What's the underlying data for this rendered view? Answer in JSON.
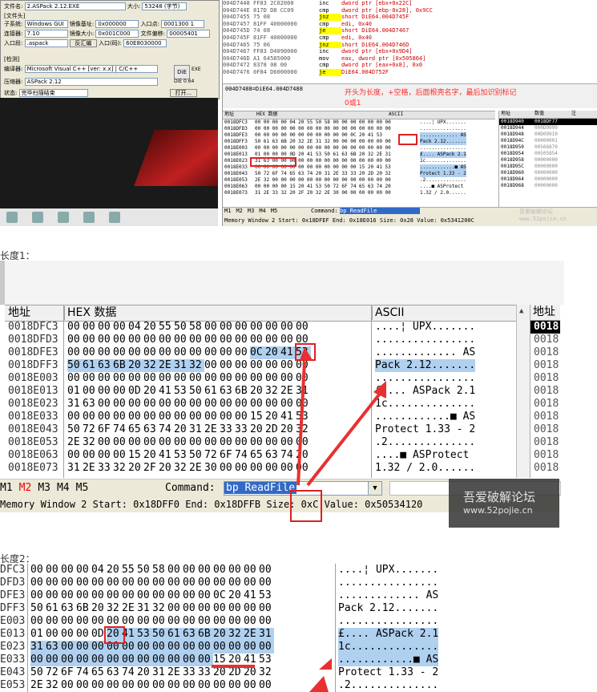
{
  "top": {
    "pe_dialog": {
      "file_label": "文件名:",
      "file_value": "2.ASPack 2.12.EXE",
      "size_label": "大小:",
      "size_value": "53248 (字节)",
      "section_title": "[文件头]",
      "subsystem_label": "子系统:",
      "subsystem_value": "Windows GUI",
      "imagebase_label": "镜像基址:",
      "imagebase_value": "0x000000",
      "entry_label": "入口点:",
      "entry_value": "0001300 1",
      "linker_label": "连接器:",
      "linker_value": "7.10",
      "imagesize_label": "镜像大小:",
      "imagesize_value": "0x001C000",
      "fileoffset_label": "文件偏移:",
      "fileoffset_value": "00005401",
      "ep_section_label": "入口段:",
      "ep_section_value": ".aspack",
      "disasm_button": "反汇编",
      "entry2_label": "入口(码):",
      "entry2_value": "60E8030000",
      "detect_title": "[检测]",
      "compiler_label": "编译器:",
      "compiler_value": "Microsoft Visual C++ [ver: x.x] | C/C++",
      "packer_label": "压缩器:",
      "packer_value": "ASPack 2.12",
      "status_label": "状态:",
      "status_value": "完毕扫描结束",
      "open_button": "打开...",
      "die_label": "DiE",
      "die_version": "DiE 0.64",
      "exe_label": "EXE"
    },
    "asm_lines": [
      {
        "addr": "004D7448",
        "bytes": "FF83 2C02000",
        "mnem": "inc",
        "op": "dword ptr [ebx+0x22C]",
        "jump": false
      },
      {
        "addr": "004D744E",
        "bytes": "817D D8 CC09",
        "mnem": "cmp",
        "op": "dword ptr [ebp-0x28], 0x9CC",
        "jump": false
      },
      {
        "addr": "004D7455",
        "bytes": "75 08",
        "mnem": "jnz",
        "op": "short DiE64.004D745F",
        "jump": true
      },
      {
        "addr": "004D7457",
        "bytes": "81FF 40000000",
        "mnem": "cmp",
        "op": "edi, 0x40",
        "jump": false
      },
      {
        "addr": "004D745D",
        "bytes": "74 08",
        "mnem": "je",
        "op": "short DiE64.004D7467",
        "jump": true
      },
      {
        "addr": "004D745F",
        "bytes": "81FF 40000000",
        "mnem": "cmp",
        "op": "edi, 0x40",
        "jump": false
      },
      {
        "addr": "004D7465",
        "bytes": "75 06",
        "mnem": "jnz",
        "op": "short DiE64.004D746D",
        "jump": true
      },
      {
        "addr": "004D7467",
        "bytes": "FF83 D4090000",
        "mnem": "inc",
        "op": "dword ptr [ebx+0x9D4]",
        "jump": false
      },
      {
        "addr": "004D746D",
        "bytes": "A1 64585000",
        "mnem": "mov",
        "op": "eax, dword ptr [0x505864]",
        "jump": false
      },
      {
        "addr": "004D7472",
        "bytes": "8378 08 00",
        "mnem": "cmp",
        "op": "dword ptr [eax+0x8], 0x0",
        "jump": false
      },
      {
        "addr": "004D7476",
        "bytes": "0F84 D6000000",
        "mnem": "je",
        "op": "DiE64.004D752F",
        "jump": true
      }
    ],
    "asm_info": "004D7488=DiE64.004D7488",
    "annotation_line1": "开头为长度，+空格，后面根壳名字，最后加识别标记",
    "annotation_line2": "0或1",
    "mini_dump_header": [
      "地址",
      "HEX 数据",
      "ASCII"
    ],
    "mini_dump_rows": [
      {
        "addr": "0018DFC3",
        "hex": "00 00 00 00 04 20 55 50 58 00 00 00 00 00 00 00",
        "ascii": "....¦ UPX......."
      },
      {
        "addr": "0018DFD3",
        "hex": "00 00 00 00 00 00 00 00 00 00 00 00 00 00 00 00",
        "ascii": "................"
      },
      {
        "addr": "0018DFE3",
        "hex": "00 00 00 00 00 00 00 00 00 00 00 0C 20 41 53",
        "ascii": "............. AS"
      },
      {
        "addr": "0018DFF3",
        "hex": "50 61 63 6B 20 32 2E 31 32 00 00 00 00 00 00 00",
        "ascii": "Pack 2.12......."
      },
      {
        "addr": "0018E003",
        "hex": "00 00 00 00 00 00 00 00 00 00 00 00 00 00 00 00",
        "ascii": "................"
      },
      {
        "addr": "0018E013",
        "hex": "01 00 00 00 0D 20 41 53 50 61 63 6B 20 32 2E 31",
        "ascii": "£.... ASPack 2.1"
      },
      {
        "addr": "0018E023",
        "hex": "31 63 00 00 00 00 00 00 00 00 00 00 00 00 00 00",
        "ascii": "1c.............."
      },
      {
        "addr": "0018E033",
        "hex": "00 00 00 00 00 00 00 00 00 00 00 00 15 20 41 53",
        "ascii": "............■ AS"
      },
      {
        "addr": "0018E043",
        "hex": "50 72 6F 74 65 63 74 20 31 2E 33 33 20 2D 20 32",
        "ascii": "Protect 1.33 - 2"
      },
      {
        "addr": "0018E053",
        "hex": "2E 32 00 00 00 00 00 00 00 00 00 00 00 00 00 00",
        "ascii": ".2.............."
      },
      {
        "addr": "0018E063",
        "hex": "00 00 00 00 15 20 41 53 50 72 6F 74 65 63 74 20",
        "ascii": "....■ ASProtect "
      },
      {
        "addr": "0018E073",
        "hex": "31 2E 33 32 20 2F 20 32 2E 30 00 00 00 00 00 00",
        "ascii": "1.32 / 2.0......"
      }
    ],
    "stack_header": [
      "地址",
      "数值",
      "注"
    ],
    "stack_rows": [
      {
        "addr": "0018D940",
        "val": "0018DF77"
      },
      {
        "addr": "0018D944",
        "val": "000D9999"
      },
      {
        "addr": "0018D948",
        "val": "00D09910"
      },
      {
        "addr": "0018D94C",
        "val": "00000001"
      },
      {
        "addr": "0018D950",
        "val": "00566870"
      },
      {
        "addr": "0018D954",
        "val": "00505854"
      },
      {
        "addr": "0018D958",
        "val": "00000000"
      },
      {
        "addr": "0018D95C",
        "val": "00000000"
      },
      {
        "addr": "0018D960",
        "val": "00000000"
      },
      {
        "addr": "0018D964",
        "val": "00000000"
      },
      {
        "addr": "0018D968",
        "val": "00000000"
      }
    ],
    "tabs": [
      "M1",
      "M2",
      "M3",
      "M4",
      "M5"
    ],
    "command_label": "Command:",
    "command_value": "bp ReadFile",
    "status": "Memory Window 2  Start: 0x18DFEF  End: 0x18E016  Size: 0x28 Value: 0x5341200C",
    "watermark": "吾爱破解论坛  www.52pojie.cn"
  },
  "section1_label": "长度1：",
  "section2_label": "长度2：",
  "dump1": {
    "header": {
      "addr": "地址",
      "hex": "HEX 数据",
      "ascii": "ASCII",
      "stack": "地址"
    },
    "rows": [
      {
        "addr": "0018DFC3",
        "hex": [
          "00",
          "00",
          "00",
          "00",
          "04",
          "20",
          "55",
          "50",
          "58",
          "00",
          "00",
          "00",
          "00",
          "00",
          "00",
          "00"
        ],
        "ascii": "....¦ UPX......."
      },
      {
        "addr": "0018DFD3",
        "hex": [
          "00",
          "00",
          "00",
          "00",
          "00",
          "00",
          "00",
          "00",
          "00",
          "00",
          "00",
          "00",
          "00",
          "00",
          "00",
          "00"
        ],
        "ascii": "................"
      },
      {
        "addr": "0018DFE3",
        "hex": [
          "00",
          "00",
          "00",
          "00",
          "00",
          "00",
          "00",
          "00",
          "00",
          "00",
          "00",
          "00",
          "0C",
          "20",
          "41",
          "53"
        ],
        "ascii": ".............  AS"
      },
      {
        "addr": "0018DFF3",
        "hex": [
          "50",
          "61",
          "63",
          "6B",
          "20",
          "32",
          "2E",
          "31",
          "32",
          "00",
          "00",
          "00",
          "00",
          "00",
          "00",
          "00"
        ],
        "ascii": "Pack 2.12......."
      },
      {
        "addr": "0018E003",
        "hex": [
          "00",
          "00",
          "00",
          "00",
          "00",
          "00",
          "00",
          "00",
          "00",
          "00",
          "00",
          "00",
          "00",
          "00",
          "00",
          "00"
        ],
        "ascii": "................"
      },
      {
        "addr": "0018E013",
        "hex": [
          "01",
          "00",
          "00",
          "00",
          "0D",
          "20",
          "41",
          "53",
          "50",
          "61",
          "63",
          "6B",
          "20",
          "32",
          "2E",
          "31"
        ],
        "ascii": "£.... ASPack 2.1"
      },
      {
        "addr": "0018E023",
        "hex": [
          "31",
          "63",
          "00",
          "00",
          "00",
          "00",
          "00",
          "00",
          "00",
          "00",
          "00",
          "00",
          "00",
          "00",
          "00",
          "00"
        ],
        "ascii": "1c.............."
      },
      {
        "addr": "0018E033",
        "hex": [
          "00",
          "00",
          "00",
          "00",
          "00",
          "00",
          "00",
          "00",
          "00",
          "00",
          "00",
          "00",
          "15",
          "20",
          "41",
          "53"
        ],
        "ascii": "............■ AS"
      },
      {
        "addr": "0018E043",
        "hex": [
          "50",
          "72",
          "6F",
          "74",
          "65",
          "63",
          "74",
          "20",
          "31",
          "2E",
          "33",
          "33",
          "20",
          "2D",
          "20",
          "32"
        ],
        "ascii": "Protect 1.33 - 2"
      },
      {
        "addr": "0018E053",
        "hex": [
          "2E",
          "32",
          "00",
          "00",
          "00",
          "00",
          "00",
          "00",
          "00",
          "00",
          "00",
          "00",
          "00",
          "00",
          "00",
          "00"
        ],
        "ascii": ".2.............."
      },
      {
        "addr": "0018E063",
        "hex": [
          "00",
          "00",
          "00",
          "00",
          "15",
          "20",
          "41",
          "53",
          "50",
          "72",
          "6F",
          "74",
          "65",
          "63",
          "74",
          "20"
        ],
        "ascii": "....■ ASProtect"
      },
      {
        "addr": "0018E073",
        "hex": [
          "31",
          "2E",
          "33",
          "32",
          "20",
          "2F",
          "20",
          "32",
          "2E",
          "30",
          "00",
          "00",
          "00",
          "00",
          "00",
          "00"
        ],
        "ascii": "1.32 / 2.0......"
      }
    ],
    "stack_rows": [
      "0018",
      "0018",
      "0018",
      "0018",
      "0018",
      "0018",
      "0018",
      "0018",
      "0018",
      "0018",
      "0018",
      "0018"
    ],
    "tabs": [
      "M1",
      "M2",
      "M3",
      "M4",
      "M5"
    ],
    "active_tab": "M2",
    "command_label": "Command:",
    "command_value": "bp ReadFile",
    "status": "Memory Window 2  Start: 0x18DFF0  End: 0x18DFFB  Size: 0xC  Value: 0x50534120",
    "watermark_title": "吾爱破解论坛",
    "watermark_url": "www.52pojie.cn"
  },
  "dump2": {
    "rows": [
      {
        "addr": "DFC3",
        "hex": [
          "00",
          "00",
          "00",
          "00",
          "04",
          "20",
          "55",
          "50",
          "58",
          "00",
          "00",
          "00",
          "00",
          "00",
          "00",
          "00"
        ],
        "ascii": "....¦ UPX......."
      },
      {
        "addr": "DFD3",
        "hex": [
          "00",
          "00",
          "00",
          "00",
          "00",
          "00",
          "00",
          "00",
          "00",
          "00",
          "00",
          "00",
          "00",
          "00",
          "00",
          "00"
        ],
        "ascii": "................"
      },
      {
        "addr": "DFE3",
        "hex": [
          "00",
          "00",
          "00",
          "00",
          "00",
          "00",
          "00",
          "00",
          "00",
          "00",
          "00",
          "00",
          "0C",
          "20",
          "41",
          "53"
        ],
        "ascii": "............. AS"
      },
      {
        "addr": "DFF3",
        "hex": [
          "50",
          "61",
          "63",
          "6B",
          "20",
          "32",
          "2E",
          "31",
          "32",
          "00",
          "00",
          "00",
          "00",
          "00",
          "00",
          "00"
        ],
        "ascii": "Pack 2.12......."
      },
      {
        "addr": "E003",
        "hex": [
          "00",
          "00",
          "00",
          "00",
          "00",
          "00",
          "00",
          "00",
          "00",
          "00",
          "00",
          "00",
          "00",
          "00",
          "00",
          "00"
        ],
        "ascii": "................"
      },
      {
        "addr": "E013",
        "hex": [
          "01",
          "00",
          "00",
          "00",
          "0D",
          "20",
          "41",
          "53",
          "50",
          "61",
          "63",
          "6B",
          "20",
          "32",
          "2E",
          "31"
        ],
        "ascii": "£.... ASPack 2.1"
      },
      {
        "addr": "E023",
        "hex": [
          "31",
          "63",
          "00",
          "00",
          "00",
          "00",
          "00",
          "00",
          "00",
          "00",
          "00",
          "00",
          "00",
          "00",
          "00",
          "00"
        ],
        "ascii": "1c.............."
      },
      {
        "addr": "E033",
        "hex": [
          "00",
          "00",
          "00",
          "00",
          "00",
          "00",
          "00",
          "00",
          "00",
          "00",
          "00",
          "00",
          "15",
          "20",
          "41",
          "53"
        ],
        "ascii": "............■ AS"
      },
      {
        "addr": "E043",
        "hex": [
          "50",
          "72",
          "6F",
          "74",
          "65",
          "63",
          "74",
          "20",
          "31",
          "2E",
          "33",
          "33",
          "20",
          "2D",
          "20",
          "32"
        ],
        "ascii": "Protect 1.33 - 2"
      },
      {
        "addr": "E053",
        "hex": [
          "2E",
          "32",
          "00",
          "00",
          "00",
          "00",
          "00",
          "00",
          "00",
          "00",
          "00",
          "00",
          "00",
          "00",
          "00",
          "00"
        ],
        "ascii": ".2.............."
      }
    ]
  },
  "colors": {
    "highlight": "#b0d0f0",
    "annotation_red": "#e02020",
    "selection_blue": "#3169c6"
  }
}
